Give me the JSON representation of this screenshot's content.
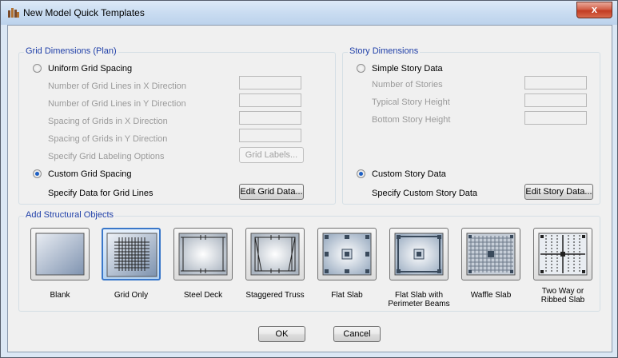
{
  "window": {
    "title": "New Model Quick Templates",
    "close_glyph": "x"
  },
  "grid": {
    "group_title": "Grid Dimensions (Plan)",
    "uniform_label": "Uniform Grid Spacing",
    "fields": [
      "Number of Grid Lines in X Direction",
      "Number of Grid Lines in Y Direction",
      "Spacing of Grids in X Direction",
      "Spacing of Grids in Y Direction"
    ],
    "labeling_label": "Specify Grid Labeling Options",
    "labels_button": "Grid Labels...",
    "custom_label": "Custom Grid Spacing",
    "custom_specify": "Specify Data for Grid Lines",
    "edit_button": "Edit Grid Data...",
    "selected": "custom"
  },
  "story": {
    "group_title": "Story Dimensions",
    "simple_label": "Simple Story Data",
    "fields": [
      "Number of Stories",
      "Typical Story Height",
      "Bottom Story Height"
    ],
    "custom_label": "Custom Story Data",
    "custom_specify": "Specify Custom Story Data",
    "edit_button": "Edit Story Data...",
    "selected": "custom"
  },
  "objects": {
    "group_title": "Add Structural Objects",
    "items": [
      {
        "label": "Blank",
        "icon": "blank-icon"
      },
      {
        "label": "Grid Only",
        "icon": "grid-only-icon",
        "selected": true
      },
      {
        "label": "Steel Deck",
        "icon": "steel-deck-icon"
      },
      {
        "label": "Staggered Truss",
        "icon": "staggered-truss-icon"
      },
      {
        "label": "Flat Slab",
        "icon": "flat-slab-icon"
      },
      {
        "label": "Flat Slab with Perimeter Beams",
        "icon": "flat-slab-perimeter-icon"
      },
      {
        "label": "Waffle Slab",
        "icon": "waffle-slab-icon"
      },
      {
        "label": "Two Way or Ribbed Slab",
        "icon": "ribbed-slab-icon"
      }
    ]
  },
  "footer": {
    "ok": "OK",
    "cancel": "Cancel"
  },
  "colors": {
    "accent": "#1f3fa8",
    "selected_border": "#3a77c9",
    "close": "#c23b22"
  }
}
